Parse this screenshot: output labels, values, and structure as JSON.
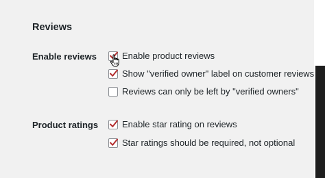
{
  "section": {
    "title": "Reviews"
  },
  "rows": [
    {
      "label": "Enable reviews",
      "options": [
        {
          "label": "Enable product reviews",
          "checked": true
        },
        {
          "label": "Show \"verified owner\" label on customer reviews",
          "checked": true
        },
        {
          "label": "Reviews can only be left by \"verified owners\"",
          "checked": false
        }
      ]
    },
    {
      "label": "Product ratings",
      "options": [
        {
          "label": "Enable star rating on reviews",
          "checked": true
        },
        {
          "label": "Star ratings should be required, not optional",
          "checked": true
        }
      ]
    }
  ],
  "colors": {
    "check_mark": "#b32d2e",
    "background": "#f1f1f1"
  },
  "icons": {
    "checkmark": "checkmark-icon",
    "cursor": "hand-pointer-icon"
  }
}
